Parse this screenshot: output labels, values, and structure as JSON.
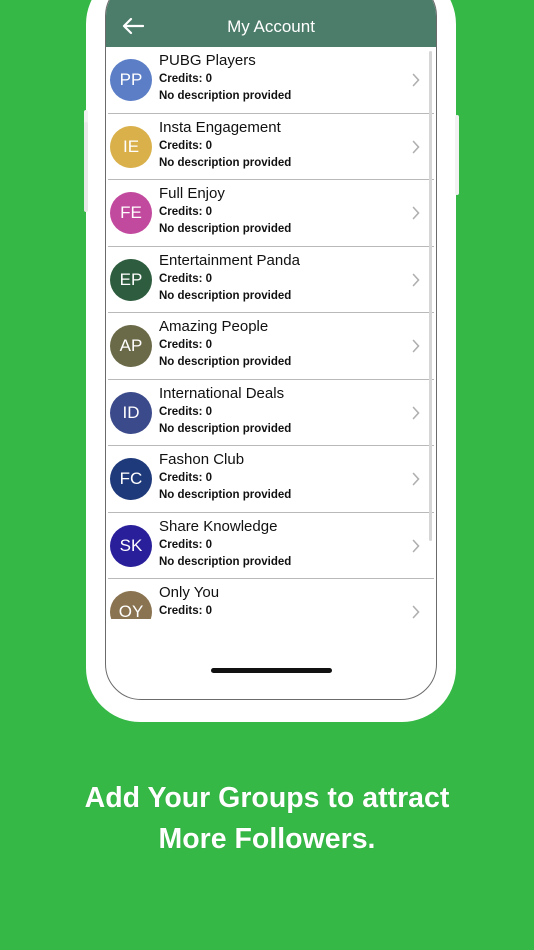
{
  "header": {
    "title": "My Account",
    "back_icon": "arrow-left-icon"
  },
  "groups": [
    {
      "initials": "PP",
      "name": "PUBG Players",
      "credits": "Credits: 0",
      "description": "No description provided",
      "color": "#5b7ec6"
    },
    {
      "initials": "IE",
      "name": "Insta Engagement",
      "credits": "Credits: 0",
      "description": "No description provided",
      "color": "#d9b04a"
    },
    {
      "initials": "FE",
      "name": "Full Enjoy",
      "credits": "Credits: 0",
      "description": "No description provided",
      "color": "#c24a9e"
    },
    {
      "initials": "EP",
      "name": "Entertainment Panda",
      "credits": "Credits: 0",
      "description": "No description provided",
      "color": "#2e5c3e"
    },
    {
      "initials": "AP",
      "name": "Amazing People",
      "credits": "Credits: 0",
      "description": "No description provided",
      "color": "#6b6a48"
    },
    {
      "initials": "ID",
      "name": "International Deals",
      "credits": "Credits: 0",
      "description": "No description provided",
      "color": "#3b4a8a"
    },
    {
      "initials": "FC",
      "name": "Fashon Club",
      "credits": "Credits: 0",
      "description": "No description provided",
      "color": "#1f3a7a"
    },
    {
      "initials": "SK",
      "name": "Share Knowledge",
      "credits": "Credits: 0",
      "description": "No description provided",
      "color": "#2a1f9a"
    },
    {
      "initials": "OY",
      "name": "Only You",
      "credits": "Credits: 0",
      "description": "",
      "color": "#8a7350"
    }
  ],
  "caption": {
    "line1": "Add Your Groups to attract",
    "line2": "More Followers."
  },
  "colors": {
    "background": "#35b845",
    "header": "#4c7c6a"
  }
}
